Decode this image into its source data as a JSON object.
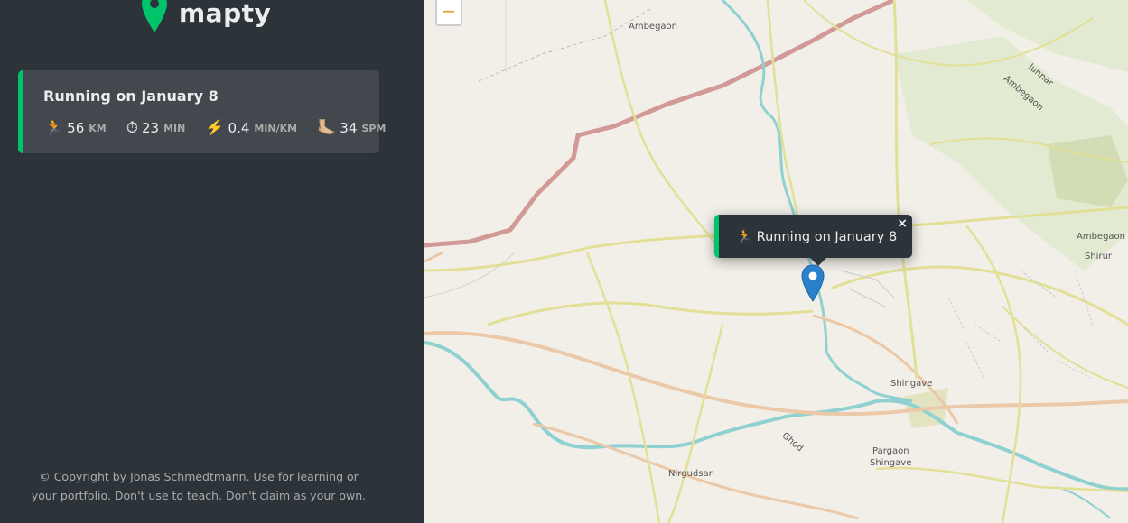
{
  "app": {
    "name": "mapty"
  },
  "workout": {
    "title": "Running on January 8",
    "distance": {
      "icon": "🏃",
      "value": "56",
      "unit": "km"
    },
    "duration": {
      "icon": "⏱",
      "value": "23",
      "unit": "min"
    },
    "pace": {
      "icon": "⚡️",
      "value": "0.4",
      "unit": "min/km"
    },
    "cadence": {
      "icon": "🦶🏼",
      "value": "34",
      "unit": "spm"
    }
  },
  "copyright": {
    "prefix": "© Copyright by ",
    "author": "Jonas Schmedtmann",
    "suffix": ". Use for learning or your portfolio. Don't use to teach. Don't claim as your own."
  },
  "map": {
    "zoom_out_label": "−",
    "places": {
      "ambegaon_top": "Ambegaon",
      "junnar": "Junnar",
      "ambegaon_ne": "Ambegaon",
      "ambegaon_right": "Ambegaon",
      "shirur": "Shirur",
      "shingave": "Shingave",
      "ghod": "Ghod",
      "pargaon": "Pargaon",
      "shingave2": "Shingave",
      "nirgudsar": "Nirgudsar"
    },
    "popup": {
      "icon": "🏃",
      "text": "Running on January 8",
      "close": "×"
    }
  },
  "colors": {
    "accent": "#00c46a",
    "dark": "#2d3439",
    "panel": "#42484d"
  }
}
